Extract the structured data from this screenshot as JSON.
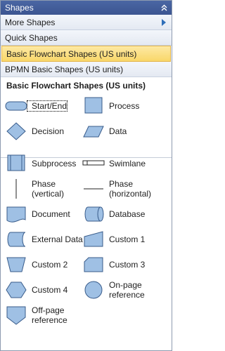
{
  "header": {
    "title": "Shapes"
  },
  "menu": {
    "more_shapes": "More Shapes",
    "quick_shapes": "Quick Shapes",
    "stencils": [
      "Basic Flowchart Shapes (US units)",
      "BPMN Basic Shapes (US units)"
    ]
  },
  "stencil": {
    "title": "Basic Flowchart Shapes (US units)",
    "shapes": [
      "Start/End",
      "Process",
      "Decision",
      "Data",
      "Subprocess",
      "Swimlane",
      "Phase\n(vertical)",
      "Phase\n(horizontal)",
      "Document",
      "Database",
      "External Data",
      "Custom 1",
      "Custom 2",
      "Custom 3",
      "Custom 4",
      "On-page\nreference",
      "Off-page\nreference"
    ]
  },
  "colors": {
    "shape_fill": "#9fc0e4",
    "shape_stroke": "#385b8a",
    "header_bg": "#3c5591",
    "selected_bg": "#f9d769"
  }
}
